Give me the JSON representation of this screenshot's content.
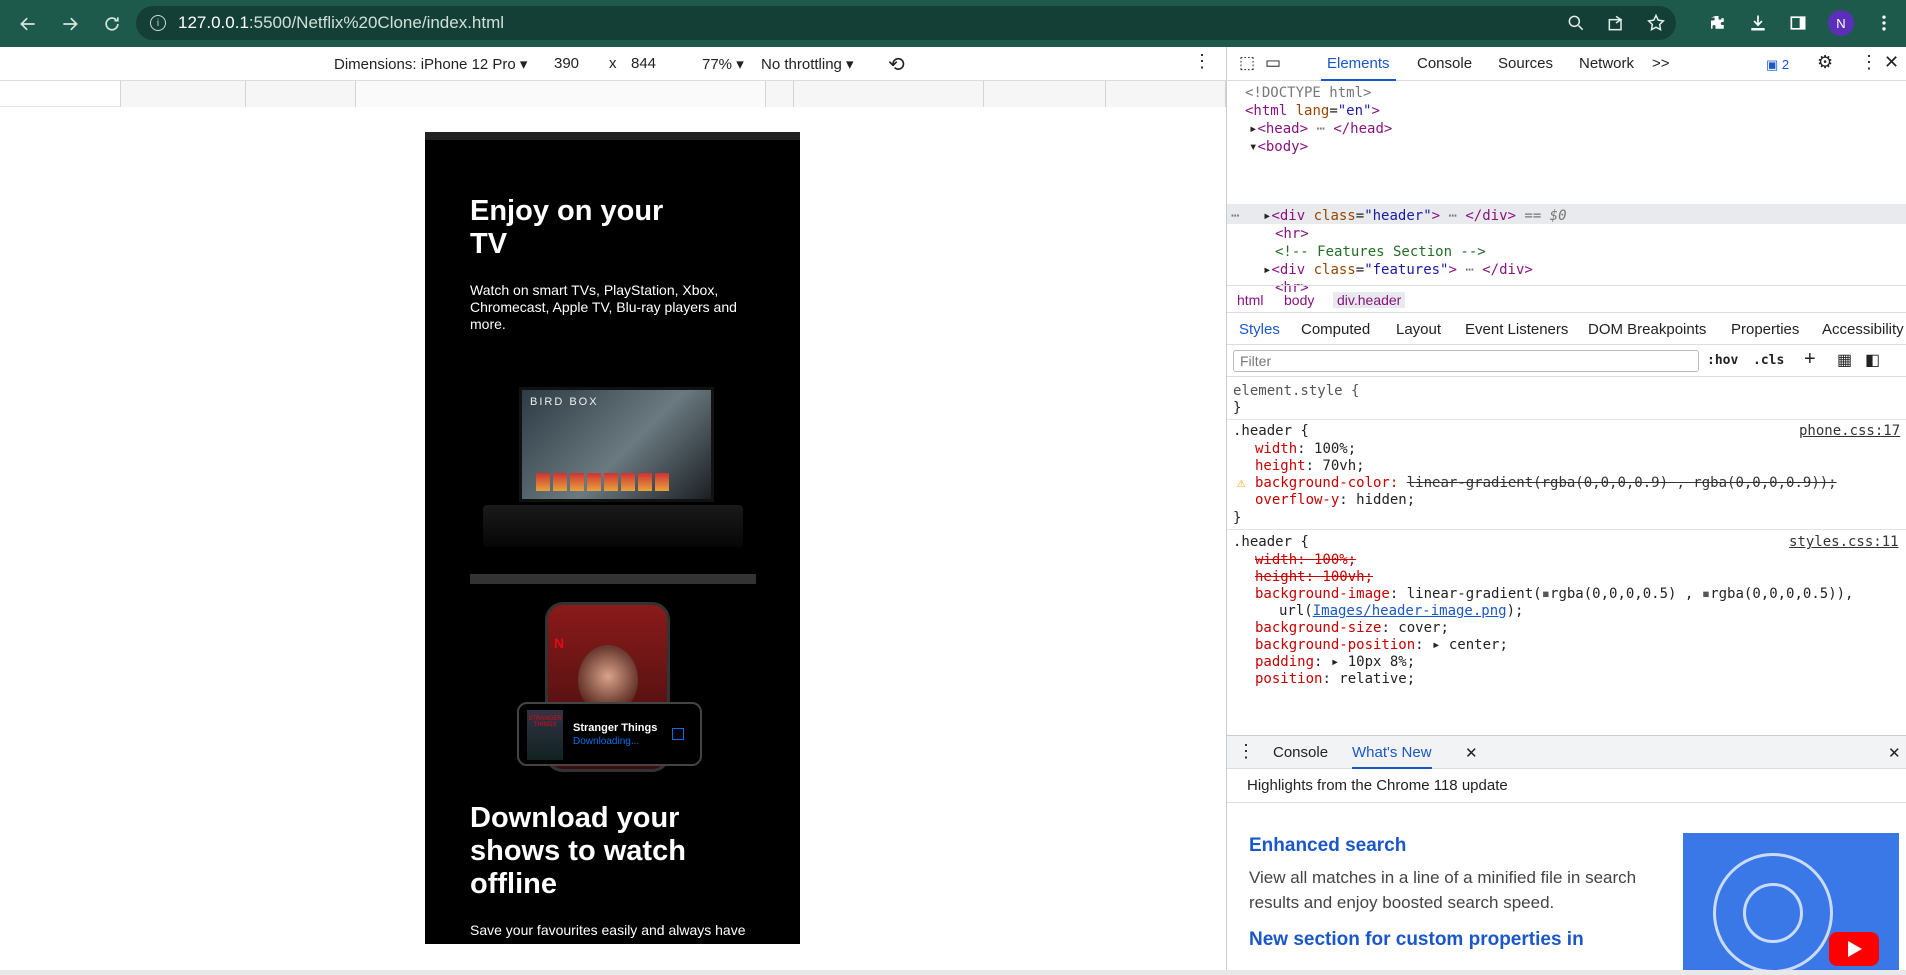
{
  "browser": {
    "url_host": "127.0.0.1",
    "url_rest": ":5500/Netflix%20Clone/index.html",
    "profile_initial": "N"
  },
  "device_toolbar": {
    "dimensions_label": "Dimensions: iPhone 12 Pro",
    "width": "390",
    "times": "x",
    "height": "844",
    "zoom": "77%",
    "throttling": "No throttling"
  },
  "phone": {
    "section1_title": "Enjoy on your TV",
    "section1_text": "Watch on smart TVs, PlayStation, Xbox, Chromecast, Apple TV, Blu-ray players and more.",
    "tv_brand": "BIRD BOX",
    "card_title": "Stranger Things",
    "card_status": "Downloading...",
    "card_thumb": "STRANGER THINGS",
    "section2_title": "Download your shows to watch offline",
    "section2_text": "Save your favourites easily and always have"
  },
  "devtools": {
    "tabs": [
      "Elements",
      "Console",
      "Sources",
      "Network"
    ],
    "more_tabs": ">>",
    "issues_count": "2",
    "dom": {
      "doctype": "<!DOCTYPE html>",
      "html_open": "<html",
      "lang_attr": "lang",
      "lang_val": "\"en\"",
      "head": "<head>",
      "head_close": "</head>",
      "body": "<body>",
      "div": "<div",
      "class_attr": "class",
      "header_val": "\"header\"",
      "div_close": "</div>",
      "eq": "== $0",
      "hr": "<hr>",
      "comment": "<!-- Features Section -->",
      "features_val": "\"features\""
    },
    "breadcrumbs": [
      "html",
      "body",
      "div.header"
    ],
    "sub_tabs": [
      "Styles",
      "Computed",
      "Layout",
      "Event Listeners",
      "DOM Breakpoints",
      "Properties",
      "Accessibility"
    ],
    "filter_placeholder": "Filter",
    "hov": ":hov",
    "cls": ".cls",
    "styles": {
      "element_style": "element.style {",
      "close": "}",
      "rule1_selector": ".header {",
      "rule1_src": "phone.css:17",
      "rule1_width": "width: 100%;",
      "rule1_height": "height: 70vh;",
      "rule1_bg": "background-color:",
      "rule1_bg_val": "linear-gradient(rgba(0,0,0,0.9) , rgba(0,0,0,0.9));",
      "rule1_overflow": "overflow-y: hidden;",
      "rule2_selector": ".header {",
      "rule2_src": "styles.css:11",
      "rule2_width": "width: 100%;",
      "rule2_height": "height: 100vh;",
      "rule2_bgimg": "background-image: linear-gradient(",
      "rule2_bgimg_a": "rgba(0,0,0,0.5) ,",
      "rule2_bgimg_b": "rgba(0,0,0,0.5)),",
      "rule2_url_pre": "url(",
      "rule2_url": "Images/header-image.png",
      "rule2_url_post": ");",
      "rule2_size": "background-size: cover;",
      "rule2_pos": "background-position:",
      "rule2_pos_val": "center;",
      "rule2_padding": "padding:",
      "rule2_padding_val": "10px 8%;",
      "rule2_position": "position: relative;"
    },
    "drawer_tabs": [
      "Console",
      "What's New"
    ],
    "highlights": "Highlights from the Chrome 118 update",
    "news1_title": "Enhanced search",
    "news1_text": "View all matches in a line of a minified file in search results and enjoy boosted search speed.",
    "news2_title": "New section for custom properties in"
  },
  "colors": {
    "browser_bar": "#1e5a4c",
    "accent": "#1a57c8",
    "netflix_red": "#e50914"
  }
}
